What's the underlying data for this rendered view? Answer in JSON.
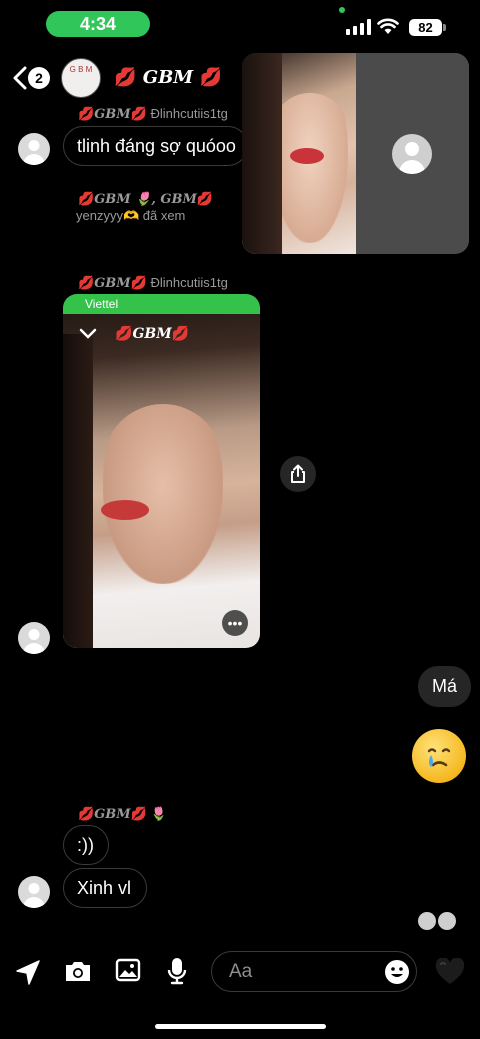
{
  "status_bar": {
    "time": "4:34",
    "battery": "82"
  },
  "header": {
    "unread_count": "2",
    "group_name": "GBM",
    "avatar_text": "G B M"
  },
  "messages": {
    "msg1_sender_tag": "GBM",
    "msg1_sender_name": "Đlinhcutiis1tg",
    "msg1_text": "tlinh đáng sợ quóoo",
    "seen_line_names": "GBM 🌷, GBM",
    "seen_line_text": "yenzyyy🫶 đã xem",
    "msg2_sender_tag": "GBM",
    "msg2_sender_name": "Đlinhcutiis1tg",
    "shot_carrier": "Viettel",
    "shot_title": "GBM",
    "my_msg": "Má",
    "my_emoji": "🥲",
    "msg3_sender_tag": "GBM",
    "msg3_flower": "🌷",
    "msg3_text_a": ":))",
    "msg3_text_b": "Xinh vl"
  },
  "composer": {
    "placeholder": "Aa"
  }
}
